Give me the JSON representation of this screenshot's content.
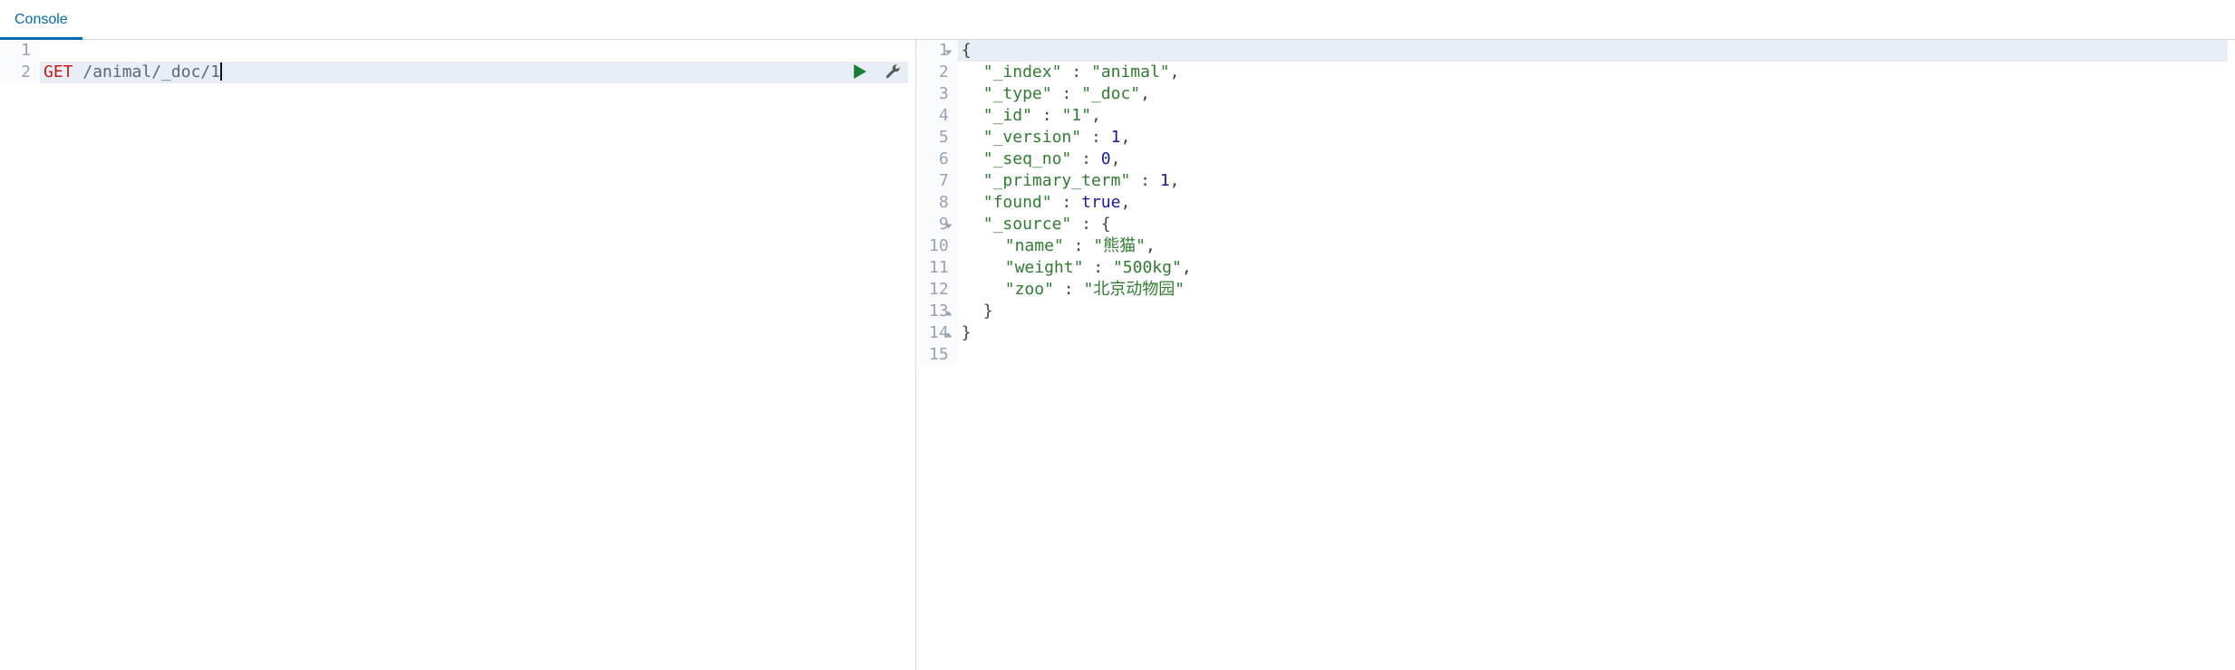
{
  "tabs": [
    {
      "label": "Console",
      "active": true
    }
  ],
  "request": {
    "lines": [
      {
        "n": 1,
        "content": "",
        "hl": false
      },
      {
        "n": 2,
        "method": "GET",
        "path": "/animal/_doc/1",
        "hl": true,
        "cursor": true
      }
    ]
  },
  "response": {
    "lines": [
      {
        "n": 1,
        "fold": "down",
        "raw_open": "{",
        "hl": true
      },
      {
        "n": 2,
        "k": "_index",
        "v": "animal",
        "t": "str",
        "comma": true
      },
      {
        "n": 3,
        "k": "_type",
        "v": "_doc",
        "t": "str",
        "comma": true
      },
      {
        "n": 4,
        "k": "_id",
        "v": "1",
        "t": "str",
        "comma": true
      },
      {
        "n": 5,
        "k": "_version",
        "v": "1",
        "t": "num",
        "comma": true
      },
      {
        "n": 6,
        "k": "_seq_no",
        "v": "0",
        "t": "num",
        "comma": true
      },
      {
        "n": 7,
        "k": "_primary_term",
        "v": "1",
        "t": "num",
        "comma": true
      },
      {
        "n": 8,
        "k": "found",
        "v": "true",
        "t": "bool",
        "comma": true
      },
      {
        "n": 9,
        "fold": "down",
        "k": "_source",
        "open": "{"
      },
      {
        "n": 10,
        "indent": 2,
        "k": "name",
        "v": "熊猫",
        "t": "str",
        "comma": true
      },
      {
        "n": 11,
        "indent": 2,
        "k": "weight",
        "v": "500kg",
        "t": "str",
        "comma": true
      },
      {
        "n": 12,
        "indent": 2,
        "k": "zoo",
        "v": "北京动物园",
        "t": "str",
        "comma": false
      },
      {
        "n": 13,
        "fold": "up",
        "indent": 1,
        "raw_close": "}"
      },
      {
        "n": 14,
        "fold": "up",
        "raw_close": "}"
      },
      {
        "n": 15
      }
    ]
  },
  "icons": {
    "play": "play-icon",
    "wrench": "wrench-icon"
  }
}
